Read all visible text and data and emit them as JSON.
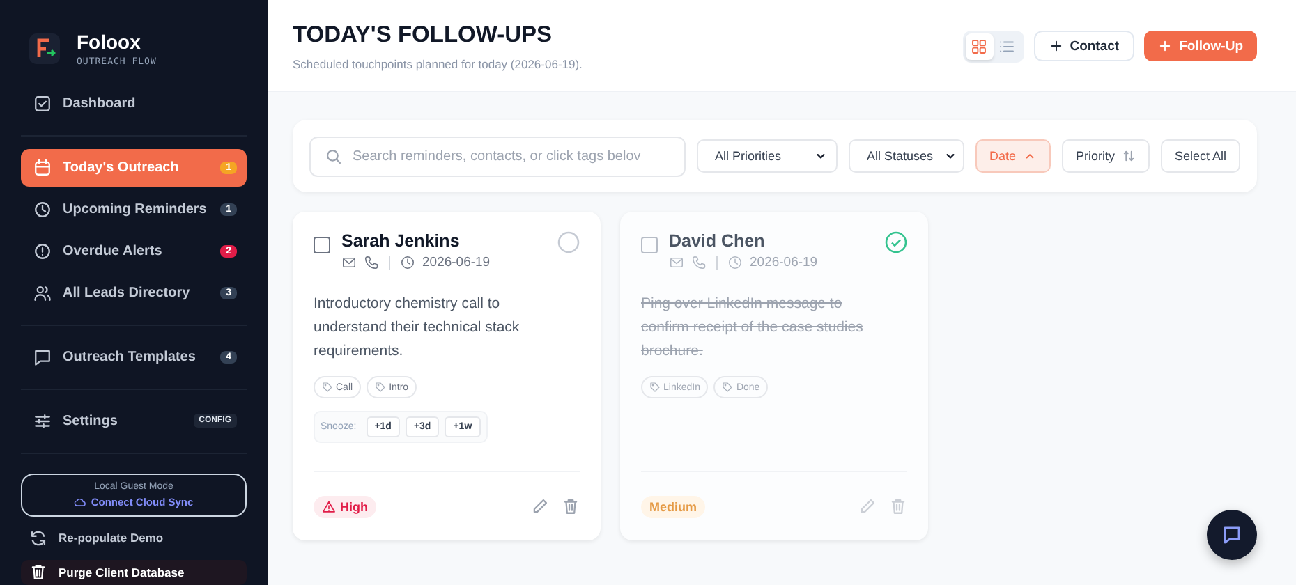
{
  "brand": {
    "name": "Foloox",
    "tagline": "OUTREACH FLOW"
  },
  "nav": [
    {
      "items": [
        {
          "label": "Dashboard",
          "selected": false
        }
      ]
    },
    {
      "items": [
        {
          "label": "Today's Outreach",
          "selected": true,
          "badge": {
            "text": "1",
            "color": "#f5a524"
          }
        },
        {
          "label": "Upcoming Reminders",
          "selected": false,
          "badge": {
            "text": "1",
            "color": "#334155"
          }
        },
        {
          "label": "Overdue Alerts",
          "selected": false,
          "badge": {
            "text": "2",
            "color": "#e11d48"
          }
        },
        {
          "label": "All Leads Directory",
          "selected": false,
          "badge": {
            "text": "3",
            "color": "#334155"
          }
        }
      ]
    },
    {
      "items": [
        {
          "label": "Outreach Templates",
          "selected": false,
          "badge": {
            "text": "4",
            "color": "#334155"
          }
        }
      ]
    },
    {
      "items": [
        {
          "label": "Settings",
          "selected": false,
          "tag": "CONFIG"
        }
      ]
    }
  ],
  "guest": {
    "title": "Local Guest Mode",
    "link": "Connect Cloud Sync"
  },
  "actions": [
    {
      "label": "Re-populate Demo",
      "kind": "refresh"
    },
    {
      "label": "Purge Client Database",
      "kind": "danger"
    }
  ],
  "header": {
    "title": "TODAY'S FOLLOW-UPS",
    "subtitle": "Scheduled touchpoints planned for today (2026-06-19).",
    "views": [
      {
        "kind": "grid",
        "selected": true
      },
      {
        "kind": "list",
        "selected": false
      }
    ],
    "buttons": [
      {
        "label": "Contact",
        "kind": "secondary"
      },
      {
        "label": "Follow-Up",
        "kind": "primary"
      }
    ]
  },
  "filters": {
    "search": {
      "placeholder": "Search reminders, contacts, or click tags belov"
    },
    "selects": [
      "All Priorities",
      "All Statuses"
    ],
    "sorts": [
      {
        "label": "Date",
        "selected": true,
        "kind": "asc"
      },
      {
        "label": "Priority",
        "selected": false,
        "kind": "both"
      }
    ],
    "select_all": "Select All"
  },
  "cards": [
    {
      "name": "Sarah Jenkins",
      "checked": false,
      "done": false,
      "date": "2026-06-19",
      "note": "Introductory chemistry call to understand their technical stack requirements.",
      "tags": [
        "Call",
        "Intro"
      ],
      "snooze": {
        "label": "Snooze:",
        "options": [
          "+1d",
          "+3d",
          "+1w"
        ]
      },
      "priority": {
        "label": "High",
        "kind": "high"
      }
    },
    {
      "name": "David Chen",
      "checked": false,
      "done": true,
      "date": "2026-06-19",
      "note": "Ping over LinkedIn message to confirm receipt of the case studies brochure.",
      "tags": [
        "LinkedIn",
        "Done"
      ],
      "priority": {
        "label": "Medium",
        "kind": "medium"
      }
    }
  ]
}
